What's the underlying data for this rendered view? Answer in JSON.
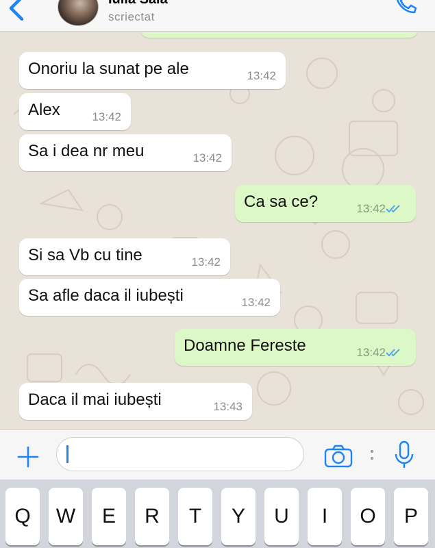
{
  "header": {
    "contact_name": "Iulia Sala",
    "status": "scriectat"
  },
  "messages": [
    {
      "direction": "in",
      "text": "Onoriu la sunat pe ale",
      "time": "13:42"
    },
    {
      "direction": "in",
      "text": "Alex",
      "time": "13:42"
    },
    {
      "direction": "in",
      "text": "Sa i dea nr meu",
      "time": "13:42"
    },
    {
      "direction": "out",
      "text": "Ca sa ce?",
      "time": "13:42",
      "status": "read"
    },
    {
      "direction": "in",
      "text": "Si sa Vb cu tine",
      "time": "13:42"
    },
    {
      "direction": "in",
      "text": "Sa afle daca il iubești",
      "time": "13:42"
    },
    {
      "direction": "out",
      "text": "Doamne Fereste",
      "time": "13:42",
      "status": "read"
    },
    {
      "direction": "in",
      "text": "Daca il mai iubești",
      "time": "13:43"
    }
  ],
  "input": {
    "value": "",
    "placeholder": ""
  },
  "icons": {
    "back": "chevron-left-icon",
    "call": "phone-icon",
    "attach": "plus-icon",
    "camera": "camera-icon",
    "more": "more-icon",
    "mic": "microphone-icon",
    "read_receipt": "double-check-icon"
  },
  "keyboard": {
    "row1": [
      "Q",
      "W",
      "E",
      "R",
      "T",
      "Y",
      "U",
      "I",
      "O",
      "P"
    ]
  },
  "colors": {
    "accent": "#1d84f5",
    "incoming_bubble": "#ffffff",
    "outgoing_bubble": "#dcf8c6",
    "read_tick": "#4fa8e8",
    "chat_background": "#e8e2d9"
  }
}
